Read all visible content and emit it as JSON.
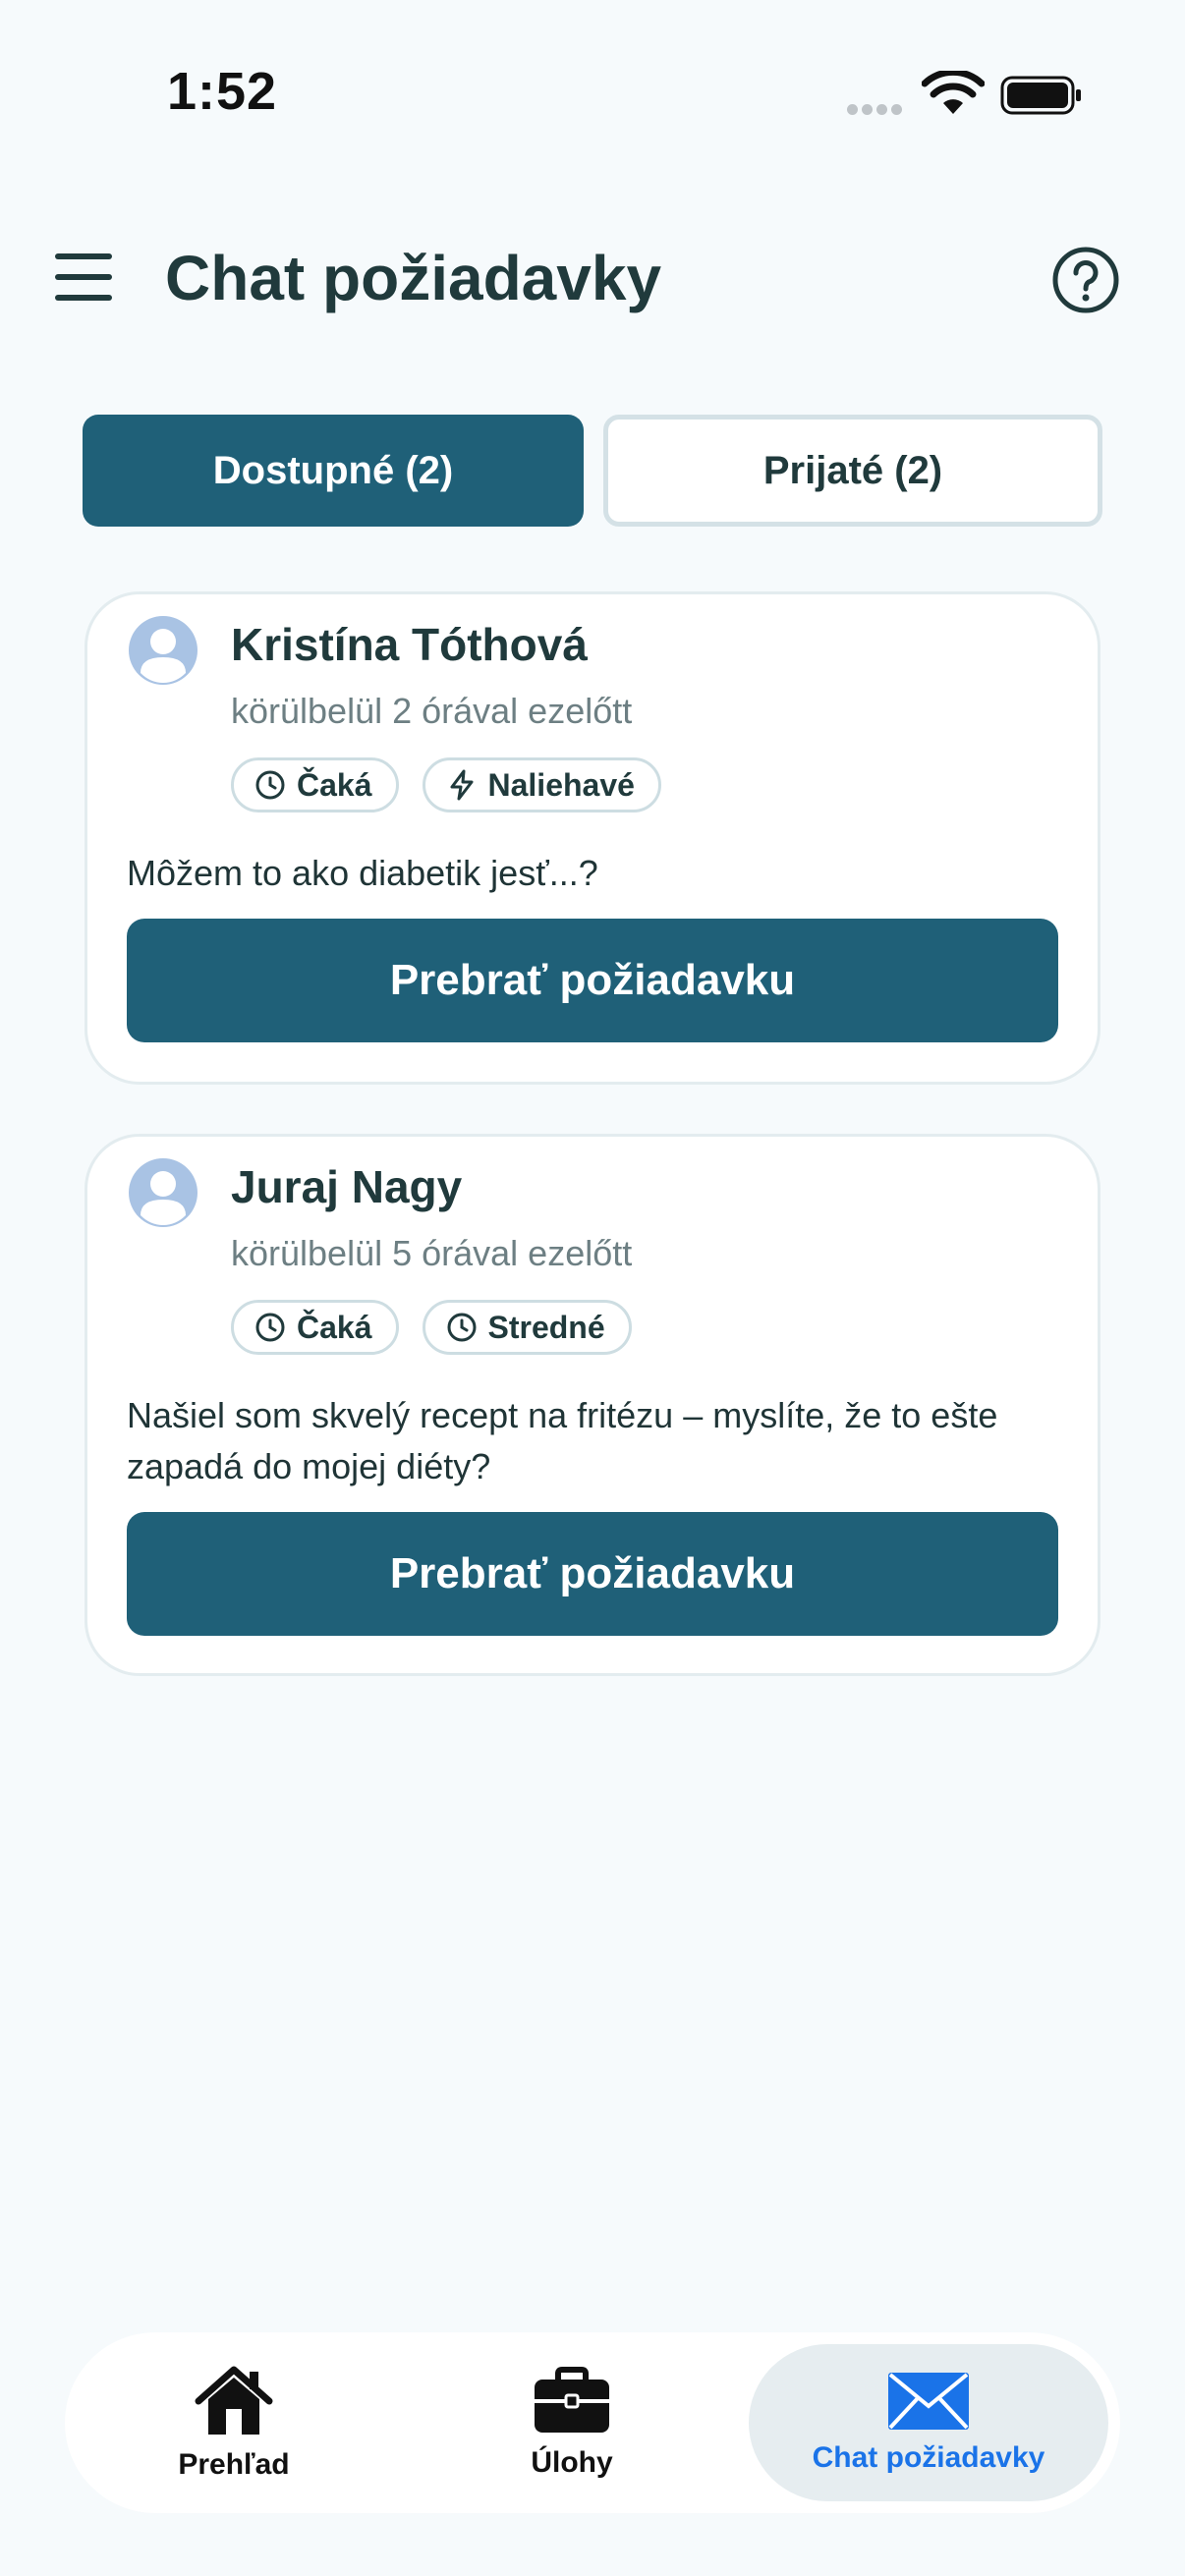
{
  "status_bar": {
    "time": "1:52"
  },
  "header": {
    "title": "Chat požiadavky"
  },
  "tabs": [
    {
      "label": "Dostupné (2)",
      "active": true
    },
    {
      "label": "Prijaté (2)",
      "active": false
    }
  ],
  "requests": [
    {
      "name": "Kristína Tóthová",
      "time": "körülbelül 2 órával ezelőtt",
      "chips": [
        {
          "icon": "clock-icon",
          "label": "Čaká"
        },
        {
          "icon": "lightning-icon",
          "label": "Naliehavé"
        }
      ],
      "message": "Môžem to ako diabetik jesť...?",
      "button_label": "Prebrať požiadavku"
    },
    {
      "name": "Juraj Nagy",
      "time": "körülbelül 5 órával ezelőtt",
      "chips": [
        {
          "icon": "clock-icon",
          "label": "Čaká"
        },
        {
          "icon": "clock-icon",
          "label": "Stredné"
        }
      ],
      "message": "Našiel som skvelý recept na fritézu – myslíte, že to ešte zapadá do mojej diéty?",
      "button_label": "Prebrať požiadavku"
    }
  ],
  "bottom_nav": [
    {
      "icon": "home-icon",
      "label": "Prehľad",
      "active": false
    },
    {
      "icon": "briefcase-icon",
      "label": "Úlohy",
      "active": false
    },
    {
      "icon": "envelope-icon",
      "label": "Chat požiadavky",
      "active": true
    }
  ],
  "colors": {
    "primary": "#1f6078",
    "active_nav": "#1a73e8",
    "background": "#f6fafc"
  }
}
